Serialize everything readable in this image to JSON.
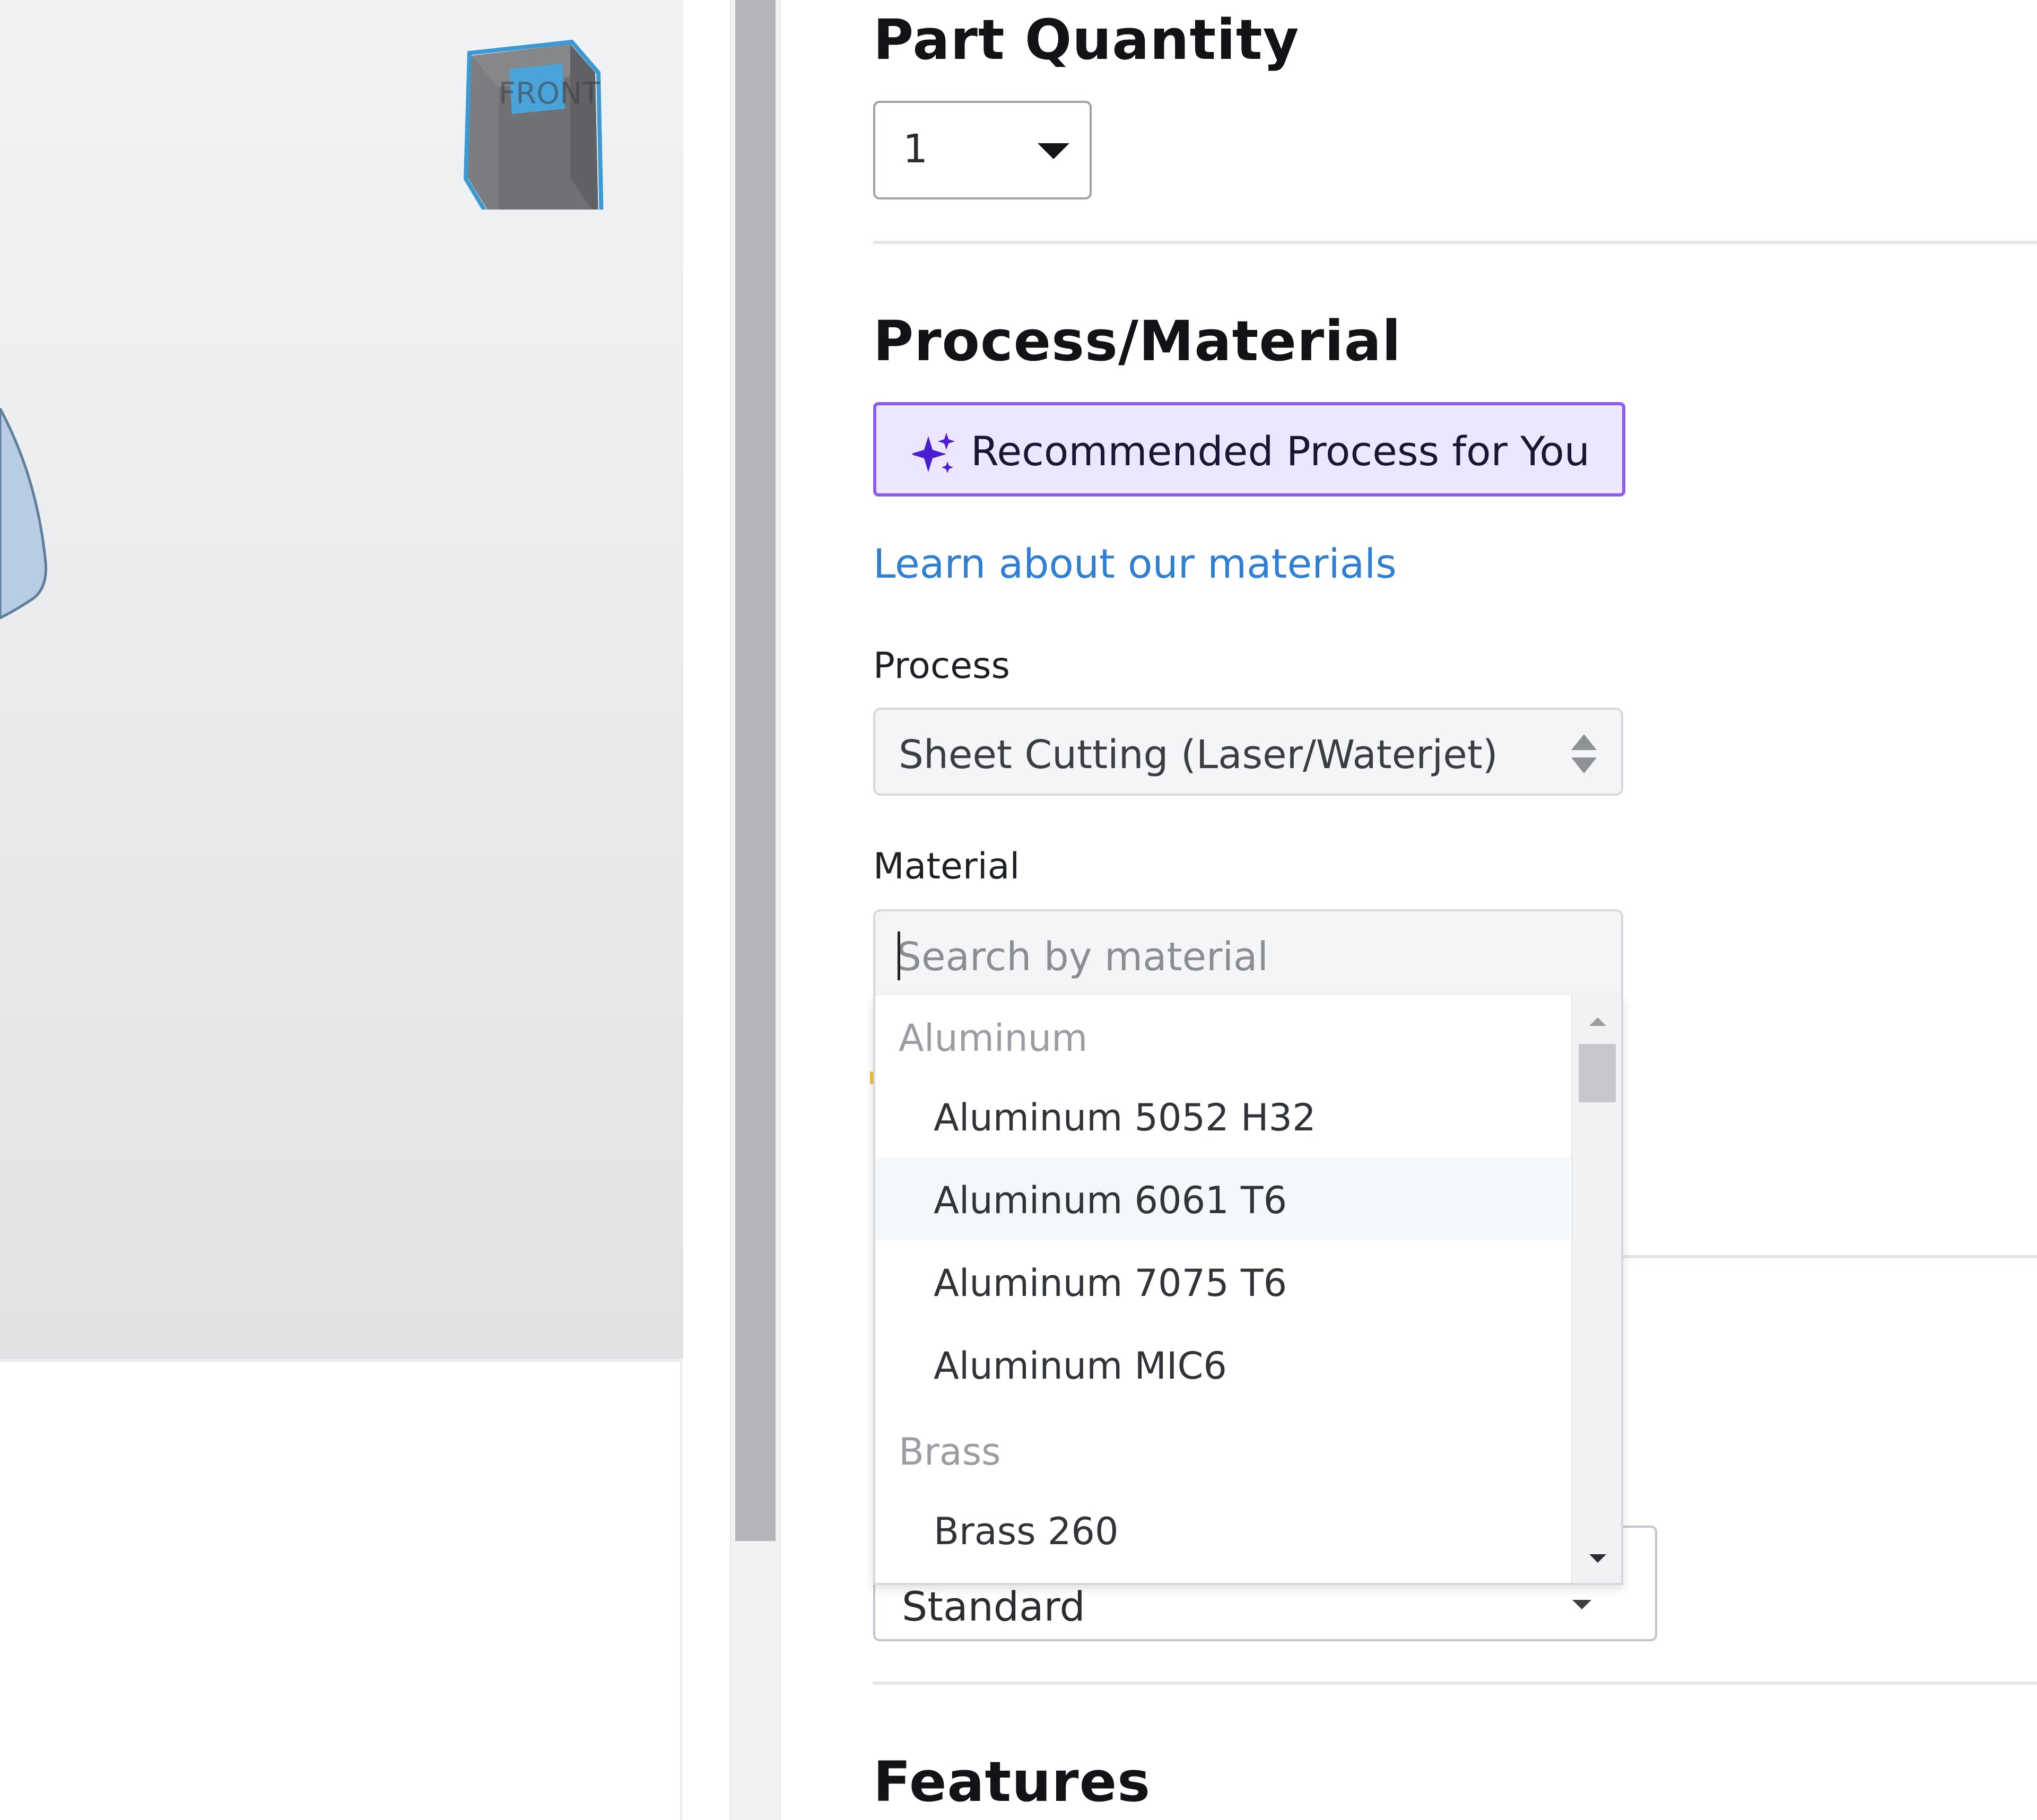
{
  "viewport": {
    "view_cube_icon": "view-cube-icon",
    "view_cube_face_label": "FRONT"
  },
  "part_quantity": {
    "title": "Part Quantity",
    "selected_value": "1",
    "caret_icon": "caret-down-icon"
  },
  "process_material": {
    "title": "Process/Material",
    "recommend_button_label": "Recommended Process for You",
    "recommend_icon": "sparkle-icon",
    "learn_link": "Learn about our materials",
    "process": {
      "label": "Process",
      "value": "Sheet Cutting (Laser/Waterjet)",
      "icon": "up-down-arrows-icon"
    },
    "material": {
      "label": "Material",
      "placeholder": "Search by material",
      "value": ""
    }
  },
  "material_dropdown": {
    "groups": [
      {
        "name": "Aluminum",
        "items": [
          "Aluminum 5052 H32",
          "Aluminum 6061 T6",
          "Aluminum 7075 T6",
          "Aluminum MIC6"
        ]
      },
      {
        "name": "Brass",
        "items": [
          "Brass 260"
        ]
      }
    ],
    "highlighted_item": "Aluminum 6061 T6"
  },
  "partially_hidden_select": {
    "value": "Standard"
  },
  "features": {
    "title": "Features"
  },
  "colors": {
    "accent_purple": "#8d5cf0",
    "recommend_bg": "#ede6ff",
    "link_blue": "#2f7fd4",
    "part_blue": "#b8cde4"
  }
}
